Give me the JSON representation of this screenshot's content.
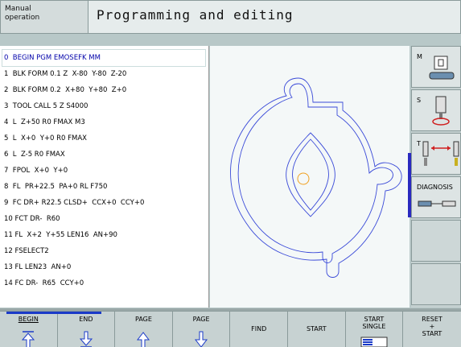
{
  "header": {
    "mode": "Manual\noperation",
    "title": "Programming and editing"
  },
  "program": {
    "lines": [
      "0  BEGIN PGM EMOSEFK MM",
      "1  BLK FORM 0.1 Z  X-80  Y-80  Z-20",
      "2  BLK FORM 0.2  X+80  Y+80  Z+0",
      "3  TOOL CALL 5 Z S4000",
      "4  L  Z+50 R0 FMAX M3",
      "5  L  X+0  Y+0 R0 FMAX",
      "6  L  Z-5 R0 FMAX",
      "7  FPOL  X+0  Y+0",
      "8  FL  PR+22.5  PA+0 RL F750",
      "9  FC DR+ R22.5 CLSD+  CCX+0  CCY+0",
      "10 FCT DR-  R60",
      "11 FL  X+2  Y+55 LEN16  AN+90",
      "12 FSELECT2",
      "13 FL LEN23  AN+0",
      "14 FC DR-  R65  CCY+0"
    ]
  },
  "sidebar": {
    "keys": [
      {
        "label": "M",
        "icon": "m-function-icon"
      },
      {
        "label": "S",
        "icon": "spindle-icon"
      },
      {
        "label": "T",
        "icon": "tool-icon"
      },
      {
        "label": "DIAGNOSIS",
        "icon": "diagnosis-icon"
      },
      {
        "label": "",
        "icon": ""
      },
      {
        "label": "",
        "icon": ""
      }
    ]
  },
  "softkeys": [
    {
      "label": "BEGIN",
      "icon": "arrow-up-icon"
    },
    {
      "label": "END",
      "icon": "arrow-down-icon"
    },
    {
      "label": "PAGE",
      "icon": "arrow-up-icon"
    },
    {
      "label": "PAGE",
      "icon": "arrow-down-icon"
    },
    {
      "label": "FIND",
      "icon": ""
    },
    {
      "label": "START",
      "icon": ""
    },
    {
      "label": "START\nSINGLE",
      "icon": "single-block-icon"
    },
    {
      "label": "RESET\n+\nSTART",
      "icon": ""
    }
  ],
  "colors": {
    "contour": "#3a4ad8",
    "selected": "#1a3ac8",
    "tool_circle": "#f0a020"
  }
}
